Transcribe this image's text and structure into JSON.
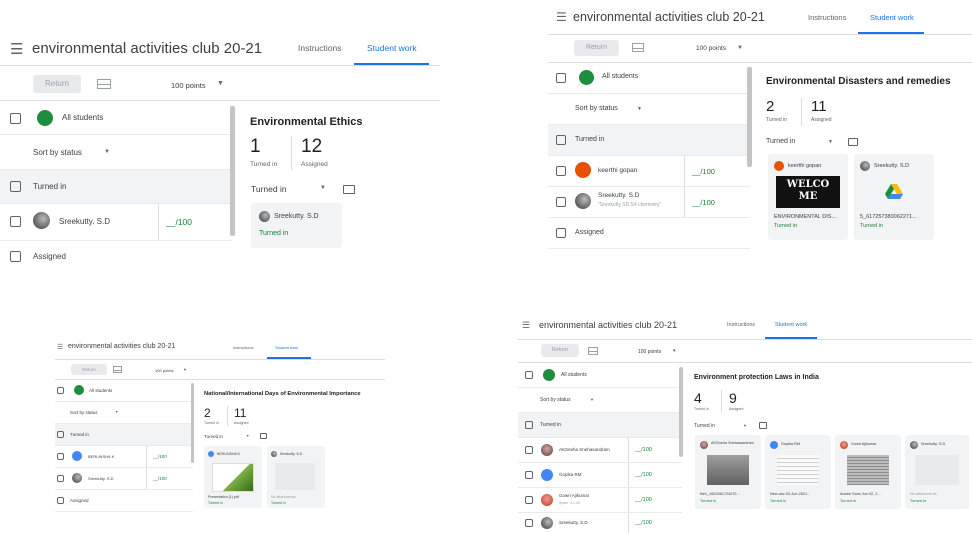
{
  "colors": {
    "accent": "#1a73e8",
    "turned_in": "#188038",
    "group": "#1e8e3e"
  },
  "p1": {
    "title": "environmental activities club 20-21",
    "tabs": [
      "Instructions",
      "Student work"
    ],
    "return": "Return",
    "points": "100 points",
    "all_students": "All students",
    "sort": "Sort by status",
    "turned_in_header": "Turned in",
    "assigned_header": "Assigned",
    "rows": [
      {
        "name": "Sreekutty. S.D",
        "grade": "__/100"
      }
    ],
    "assignment": "Environmental Ethics",
    "turned_in_count": "1",
    "assigned_count": "12",
    "turned_in_label": "Turned in",
    "assigned_label": "Assigned",
    "filter": "Turned in",
    "cards": [
      {
        "name": "Sreekutty. S.D",
        "status": "Turned in"
      }
    ]
  },
  "p2": {
    "title": "environmental activities club 20-21",
    "tabs": [
      "Instructions",
      "Student work"
    ],
    "return": "Return",
    "points": "100 points",
    "all_students": "All students",
    "sort": "Sort by status",
    "turned_in_header": "Turned in",
    "assigned_header": "Assigned",
    "rows": [
      {
        "name": "keerthi gopan",
        "sub": "",
        "grade": "__/100"
      },
      {
        "name": "Sreekutty. S.D",
        "sub": "\"Sreekutty SD S4 chemistry\"",
        "grade": "__/100"
      }
    ],
    "assignment": "Environmental Disasters and remedies",
    "turned_in_count": "2",
    "assigned_count": "11",
    "turned_in_label": "Turned in",
    "assigned_label": "Assigned",
    "filter": "Turned in",
    "cards": [
      {
        "name": "keerthi gopan",
        "file": "ENVIRONMENTAL DIS...",
        "status": "Turned in",
        "thumb_text": "WELCO ME"
      },
      {
        "name": "Sreekutty. S.D",
        "file": "5_617257380062271...",
        "status": "Turned in",
        "icon": "google-drive-icon"
      }
    ]
  },
  "p3": {
    "title": "environmental activities club 20-21",
    "tabs": [
      "Instructions",
      "Student work"
    ],
    "return": "Return",
    "points": "100 points",
    "all_students": "All students",
    "sort": "Sort by status",
    "turned_in_header": "Turned in",
    "assigned_header": "Assigned",
    "rows": [
      {
        "name": "BERLINSHA K",
        "grade": "__/100"
      },
      {
        "name": "Sreekutty. S.D",
        "grade": "__/100"
      }
    ],
    "assignment": "National/International Days of Environmental Importance",
    "turned_in_count": "2",
    "assigned_count": "11",
    "turned_in_label": "Turned in",
    "assigned_label": "Assigned",
    "filter": "Turned in",
    "cards": [
      {
        "name": "BERLINSHA K",
        "file": "Presentation (1).pdf",
        "status": "Turned in"
      },
      {
        "name": "Sreekutty. S.D",
        "file": "No attachments",
        "status": "Turned in"
      }
    ]
  },
  "p4": {
    "title": "environmental activities club 20-21",
    "tabs": [
      "Instructions",
      "Student work"
    ],
    "return": "Return",
    "points": "100 points",
    "all_students": "All students",
    "sort": "Sort by status",
    "turned_in_header": "Turned in",
    "rows": [
      {
        "name": "AKSneha Snehasandram",
        "sub": "",
        "grade": "__/100"
      },
      {
        "name": "Gopika RM",
        "sub": "",
        "grade": "__/100"
      },
      {
        "name": "Gowri Ajikumar",
        "sub": "Spam: 4.1.49",
        "grade": "__/100"
      },
      {
        "name": "Sreekutty. S.D",
        "sub": "",
        "grade": "__/100"
      }
    ],
    "assignment": "Environment protection Laws in India",
    "turned_in_count": "4",
    "assigned_count": "9",
    "turned_in_label": "Turned in",
    "assigned_label": "Assigned",
    "filter": "Turned in",
    "cards": [
      {
        "name": "AKSneha Snehasandram",
        "file": "file1_1622561724075...",
        "status": "Turned in"
      },
      {
        "name": "Gopika RM",
        "file": "New doc 02-Jun-2021...",
        "status": "Turned in"
      },
      {
        "name": "Gowri Ajikumar",
        "file": "Adobe Scan Jun 02, 2...",
        "status": "Turned in"
      },
      {
        "name": "Sreekutty. S.D",
        "file": "No attachments",
        "status": "Turned in"
      }
    ]
  }
}
